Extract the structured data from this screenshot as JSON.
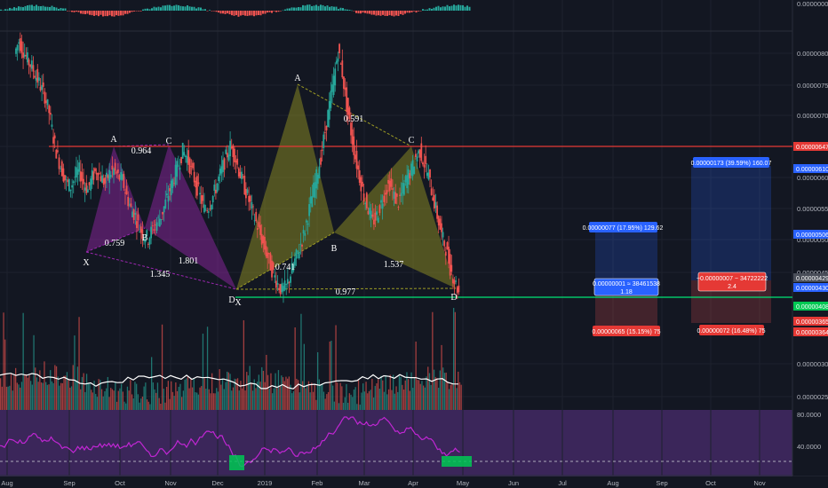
{
  "chart_data": {
    "type": "candlestick",
    "theme": {
      "background": "#131722",
      "grid": "#1e222d",
      "up": "#26a69a",
      "down": "#ef5350"
    },
    "x_tick_labels": [
      "Aug",
      "Sep",
      "Oct",
      "Nov",
      "Dec",
      "2019",
      "Feb",
      "Mar",
      "Apr",
      "May",
      "Jun",
      "Jul",
      "Aug",
      "Sep",
      "Oct",
      "Nov"
    ],
    "y_tick_labels": [
      "0.00000800",
      "0.00000750",
      "0.00000700",
      "0.00000650",
      "0.00000600",
      "0.00000550",
      "0.00000500",
      "0.00000450",
      "0.00000300",
      "0.00000250"
    ],
    "top_axis_label": "0.00000000",
    "price_tags": [
      {
        "label": "0.00000647",
        "color": "#e53935"
      },
      {
        "label": "0.00000610",
        "color": "#2962ff"
      },
      {
        "label": "0.00000506",
        "color": "#2962ff"
      },
      {
        "label": "0.00000437",
        "color": "#2a2e39"
      },
      {
        "label": "0.00000430",
        "color": "#2962ff"
      },
      {
        "label": "0.00000429",
        "color": "#4a4e59"
      },
      {
        "label": "0.00000408",
        "color": "#00c853"
      },
      {
        "label": "0.00000365",
        "color": "#e53935"
      },
      {
        "label": "0.00000364",
        "color": "#e53935"
      }
    ],
    "horizontal_lines": [
      {
        "price": 6.47,
        "color": "#e53935"
      },
      {
        "price": 4.08,
        "color": "#00e676"
      }
    ],
    "patterns": [
      {
        "name": "bat-1",
        "color": "#9c27b0",
        "points": [
          [
            "X",
            "Aug 29",
            4.86
          ],
          [
            "A",
            "Sep 28",
            6.3
          ],
          [
            "B",
            "Oct 17",
            5.38
          ],
          [
            "C",
            "Nov 1",
            6.37
          ],
          [
            "D",
            "Dec 6",
            4.14
          ]
        ]
      },
      {
        "name": "crab-2",
        "color": "#9e9d24",
        "points": [
          [
            "X",
            "Dec 10",
            4.14
          ],
          [
            "A",
            "Jan 21",
            7.85
          ],
          [
            "B",
            "Feb 10",
            5.18
          ],
          [
            "C",
            "Apr 6",
            6.3
          ],
          [
            "D",
            "Apr 29",
            4.12
          ]
        ]
      }
    ],
    "ratio_labels": [
      "0.759",
      "0.964",
      "1.345",
      "1.801",
      "0.741",
      "0.591",
      "1.537",
      "0.977"
    ],
    "point_labels": [
      "X",
      "A",
      "B",
      "C",
      "D",
      "X",
      "A",
      "B",
      "C",
      "D"
    ],
    "positions": [
      {
        "name": "long",
        "target_label": "0.00000077 (17.95%) 129.62",
        "entry_label": "0.00000001 ≈ 38461538",
        "ratio": "1.18",
        "stop_label": "0.00000065 (15.15%) 75"
      },
      {
        "name": "short",
        "target_label": "0.00000173 (39.59%) 160.07",
        "entry_label": "−0.00000007 − 34722222",
        "ratio": "2.4",
        "stop_label": "0.00000072 (16.48%) 75"
      }
    ],
    "rsi_levels": [
      "80.0000",
      "40.0000"
    ],
    "price_series": [
      7.8,
      8.0,
      7.85,
      7.7,
      7.6,
      7.45,
      7.3,
      7.15,
      6.9,
      6.5,
      6.2,
      6.0,
      5.8,
      5.75,
      5.9,
      6.0,
      5.8,
      5.7,
      5.9,
      6.0,
      5.9,
      5.8,
      5.95,
      6.0,
      5.9,
      5.85,
      5.6,
      5.4,
      5.3,
      5.1,
      5.0,
      4.95,
      5.1,
      5.2,
      5.3,
      5.5,
      5.7,
      5.9,
      6.1,
      6.3,
      6.2,
      6.0,
      5.8,
      5.6,
      5.4,
      5.45,
      5.6,
      5.8,
      6.0,
      6.2,
      6.37,
      6.25,
      6.0,
      5.8,
      5.6,
      5.4,
      5.2,
      5.0,
      4.8,
      4.6,
      4.4,
      4.25,
      4.14,
      4.2,
      4.4,
      4.6,
      4.8,
      5.0,
      5.3,
      5.6,
      5.9,
      6.2,
      6.6,
      7.0,
      7.4,
      7.85,
      7.5,
      7.0,
      6.6,
      6.2,
      5.9,
      5.6,
      5.4,
      5.2,
      5.3,
      5.5,
      5.7,
      5.8,
      5.6,
      5.5,
      5.7,
      5.9,
      6.0,
      6.2,
      6.3,
      6.1,
      5.9,
      5.6,
      5.3,
      5.0,
      4.8,
      4.5,
      4.3,
      4.12
    ]
  }
}
